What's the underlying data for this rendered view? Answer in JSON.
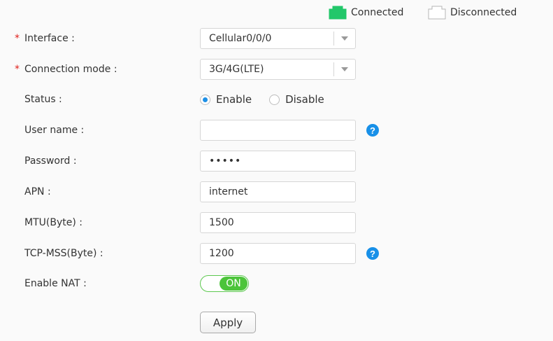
{
  "legend": {
    "connected_label": "Connected",
    "disconnected_label": "Disconnected",
    "connected_color": "#22c76a"
  },
  "form": {
    "interface": {
      "label": "Interface :",
      "required": "*",
      "value": "Cellular0/0/0"
    },
    "connection_mode": {
      "label": "Connection mode :",
      "required": "*",
      "value": "3G/4G(LTE)"
    },
    "status": {
      "label": "Status :",
      "options": [
        "Enable",
        "Disable"
      ],
      "selected": "Enable"
    },
    "user_name": {
      "label": "User name :",
      "value": ""
    },
    "password": {
      "label": "Password :",
      "value": "•••••"
    },
    "apn": {
      "label": "APN :",
      "value": "internet"
    },
    "mtu": {
      "label": "MTU(Byte) :",
      "value": "1500"
    },
    "tcp_mss": {
      "label": "TCP-MSS(Byte) :",
      "value": "1200"
    },
    "enable_nat": {
      "label": "Enable NAT :",
      "state": "ON"
    },
    "help_icon_glyph": "?",
    "apply_label": "Apply"
  },
  "colors": {
    "accent": "#1890e8",
    "toggle_on": "#4cc43a",
    "required": "#e0201b"
  }
}
